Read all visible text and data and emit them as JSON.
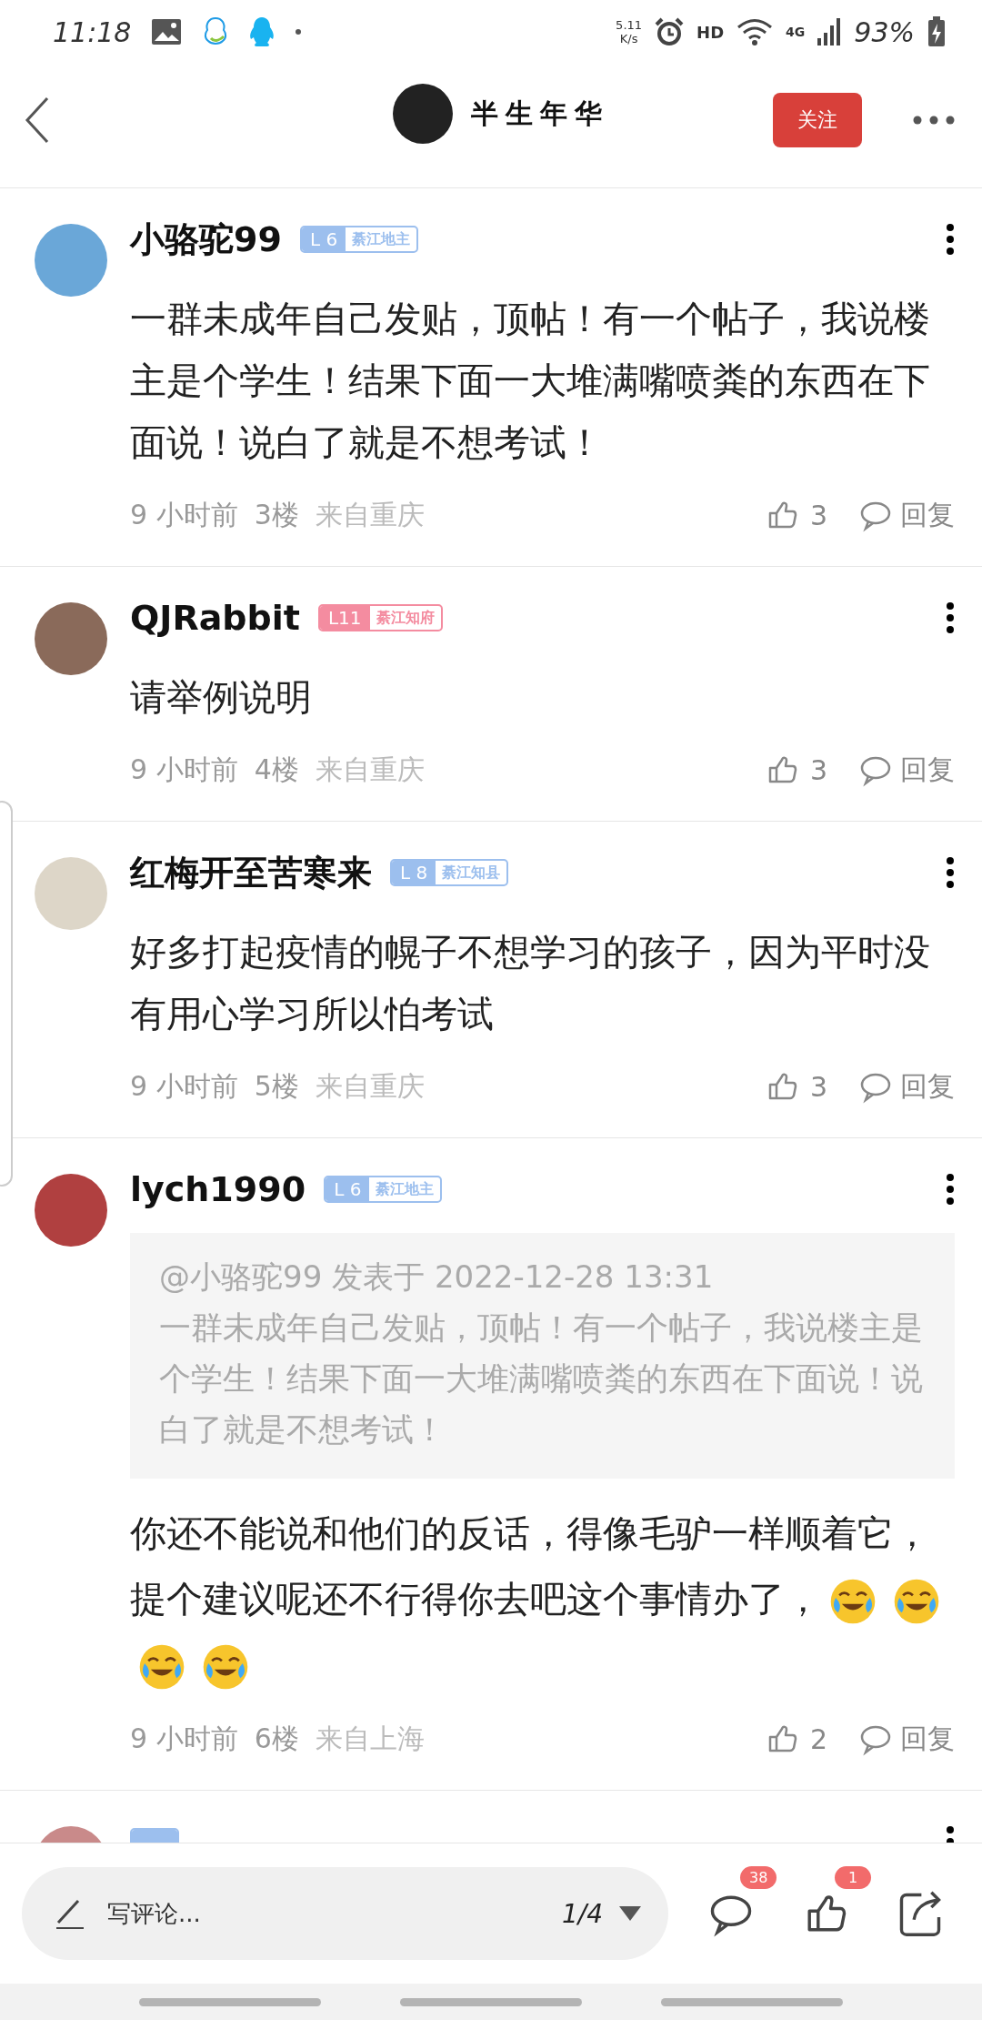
{
  "status_bar": {
    "time": "11:18",
    "speed_value": "5.11",
    "speed_unit": "K/s",
    "hd": "HD",
    "network": "4G",
    "battery": "93%"
  },
  "header": {
    "username": "半生年华",
    "follow": "关注"
  },
  "comments": [
    {
      "author": "小骆驼99",
      "level": "L 6",
      "title": "綦江地主",
      "color": "#9cbfee",
      "text": "一群未成年自己发贴，顶帖！有一个帖子，我说楼主是个学生！结果下面一大堆满嘴喷粪的东西在下面说！说白了就是不想考试！",
      "time": "9 小时前",
      "floor": "3楼",
      "location": "来自重庆",
      "likes": "3",
      "reply": "回复"
    },
    {
      "author": "QJRabbit",
      "level": "L11",
      "title": "綦江知府",
      "color": "#f48ca0",
      "text": "请举例说明",
      "time": "9 小时前",
      "floor": "4楼",
      "location": "来自重庆",
      "likes": "3",
      "reply": "回复"
    },
    {
      "author": "红梅开至苦寒来",
      "level": "L 8",
      "title": "綦江知县",
      "color": "#9cbfee",
      "text": "好多打起疫情的幌子不想学习的孩子，因为平时没有用心学习所以怕考试",
      "time": "9 小时前",
      "floor": "5楼",
      "location": "来自重庆",
      "likes": "3",
      "reply": "回复"
    },
    {
      "author": "lych1990",
      "level": "L 6",
      "title": "綦江地主",
      "color": "#9cbfee",
      "quote": {
        "header": "@小骆驼99 发表于 2022-12-28 13:31",
        "text": "一群未成年自己发贴，顶帖！有一个帖子，我说楼主是个学生！结果下面一大堆满嘴喷粪的东西在下面说！说白了就是不想考试！"
      },
      "text_lines": [
        "你还不能说和他们的反话，得像毛驴一样顺着它，",
        "提个建议呢还不行得你去吧这个事情办了，"
      ],
      "emojis": [
        {
          "kind": "laugh-cry"
        },
        {
          "kind": "laugh-cry"
        },
        {
          "kind": "laugh-cry"
        },
        {
          "kind": "laugh-cry"
        }
      ],
      "time": "9 小时前",
      "floor": "6楼",
      "location": "来自上海",
      "likes": "2",
      "reply": "回复"
    }
  ],
  "partial_comment": {
    "color": "#9cbfee"
  },
  "bottom_bar": {
    "placeholder": "写评论...",
    "page": "1/4",
    "comment_count": "38",
    "like_count": "1"
  }
}
